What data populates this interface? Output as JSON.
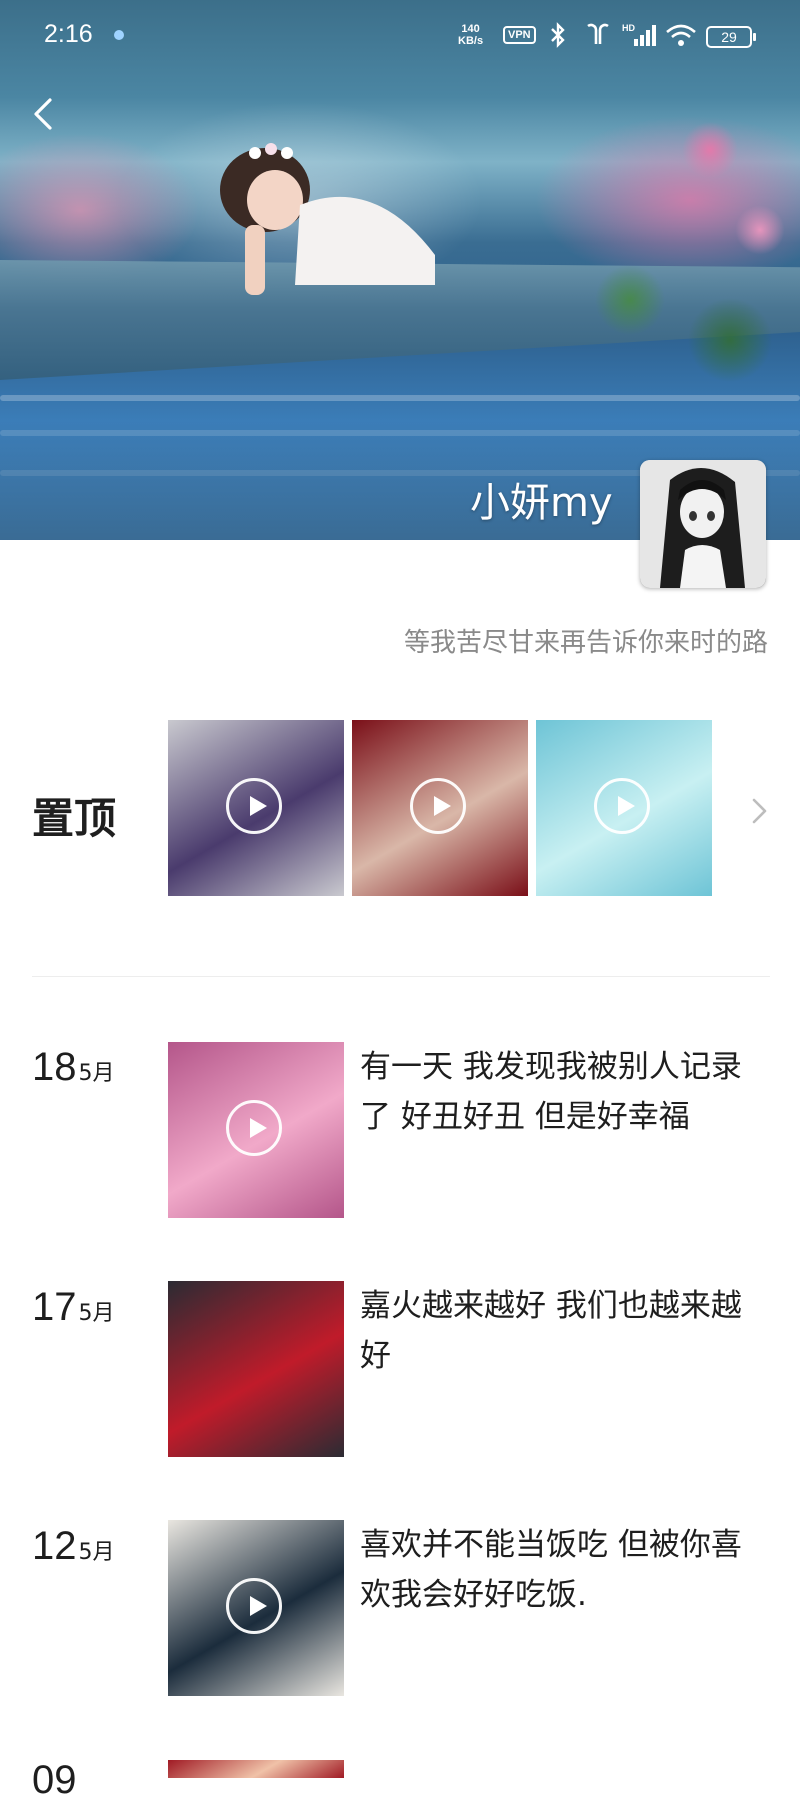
{
  "status_bar": {
    "time": "2:16",
    "network_speed_value": "140",
    "network_speed_unit": "KB/s",
    "vpn": "VPN",
    "battery": "29",
    "icons": [
      "bluetooth-icon",
      "earbuds-icon",
      "signal-icon",
      "wifi-icon",
      "battery-icon"
    ]
  },
  "profile": {
    "name": "小妍my",
    "signature": "等我苦尽甘来再告诉你来时的路"
  },
  "pinned": {
    "label": "置顶",
    "items": [
      {
        "type": "video",
        "colors": [
          "#c9c9cf",
          "#4a3b6d"
        ]
      },
      {
        "type": "video",
        "colors": [
          "#7a0f18",
          "#d9b7a8"
        ]
      },
      {
        "type": "video",
        "colors": [
          "#6ec4d6",
          "#c8f0f2"
        ]
      }
    ]
  },
  "posts": [
    {
      "day": "18",
      "month": "5月",
      "text": "有一天 我发现我被别人记录了 好丑好丑 但是好幸福",
      "video": true,
      "colors": [
        "#b4568a",
        "#f1a9c9"
      ]
    },
    {
      "day": "17",
      "month": "5月",
      "text": "嘉火越来越好 我们也越来越好",
      "video": false,
      "colors": [
        "#2b2b33",
        "#c01b2a"
      ]
    },
    {
      "day": "12",
      "month": "5月",
      "text": "喜欢并不能当饭吃 但被你喜欢我会好好吃饭.",
      "video": true,
      "colors": [
        "#e9e6e0",
        "#1b2c3c"
      ]
    },
    {
      "day": "09",
      "month": "",
      "text": "",
      "video": false,
      "colors": [
        "#a01a24",
        "#f0c2a8"
      ]
    }
  ]
}
